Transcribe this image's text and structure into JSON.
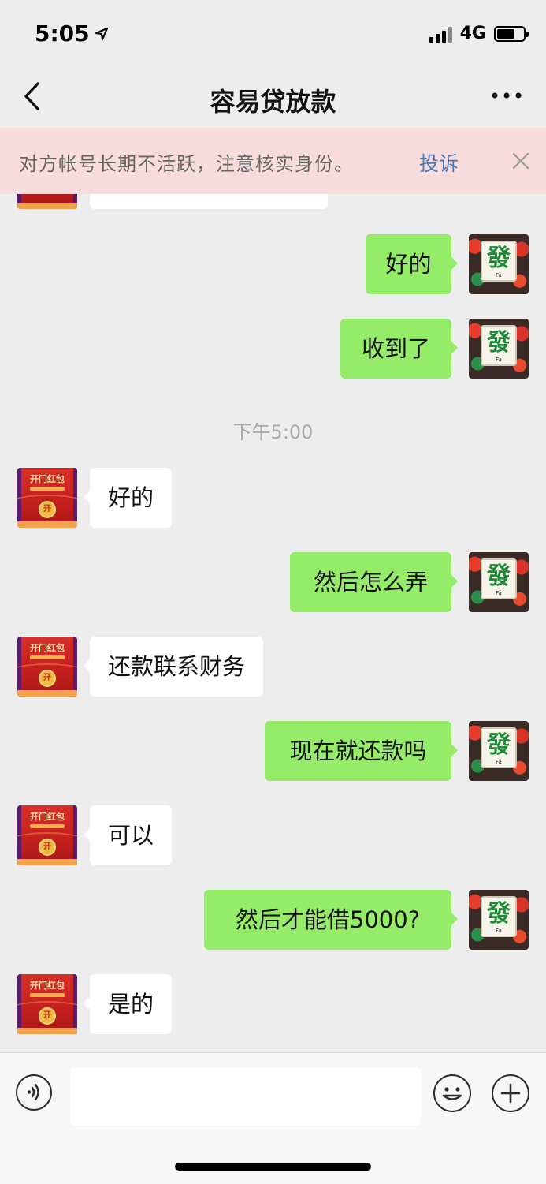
{
  "status_bar": {
    "time": "5:05",
    "network": "4G",
    "battery_level": 0.7
  },
  "nav": {
    "title": "容易贷放款",
    "back_icon": "chevron-left-icon",
    "more_icon": "ellipsis-icon"
  },
  "warning": {
    "text": "对方帐号长期不活跃，注意核实身份。",
    "action": "投诉",
    "close_icon": "close-icon"
  },
  "chat": {
    "timestamp": "下午5:00",
    "messages": [
      {
        "side": "out",
        "text": "好的"
      },
      {
        "side": "out",
        "text": "收到了"
      },
      {
        "side": "in",
        "text": "好的"
      },
      {
        "side": "out",
        "text": "然后怎么弄"
      },
      {
        "side": "in",
        "text": "还款联系财务"
      },
      {
        "side": "out",
        "text": "现在就还款吗"
      },
      {
        "side": "in",
        "text": "可以"
      },
      {
        "side": "out",
        "text": "然后才能借5000?"
      },
      {
        "side": "in",
        "text": "是的"
      }
    ],
    "contact_avatar": {
      "line1": "开门红包",
      "coin": "开"
    },
    "self_avatar": {
      "tile": "發",
      "tile_caption": "Fā"
    }
  },
  "input_bar": {
    "voice_icon": "voice-icon",
    "emoji_icon": "emoji-icon",
    "add_icon": "plus-icon",
    "input_value": ""
  },
  "colors": {
    "out_bubble": "#95ec69",
    "in_bubble": "#ffffff",
    "warning_bg": "#f8dcdd",
    "link": "#4a78b8"
  }
}
